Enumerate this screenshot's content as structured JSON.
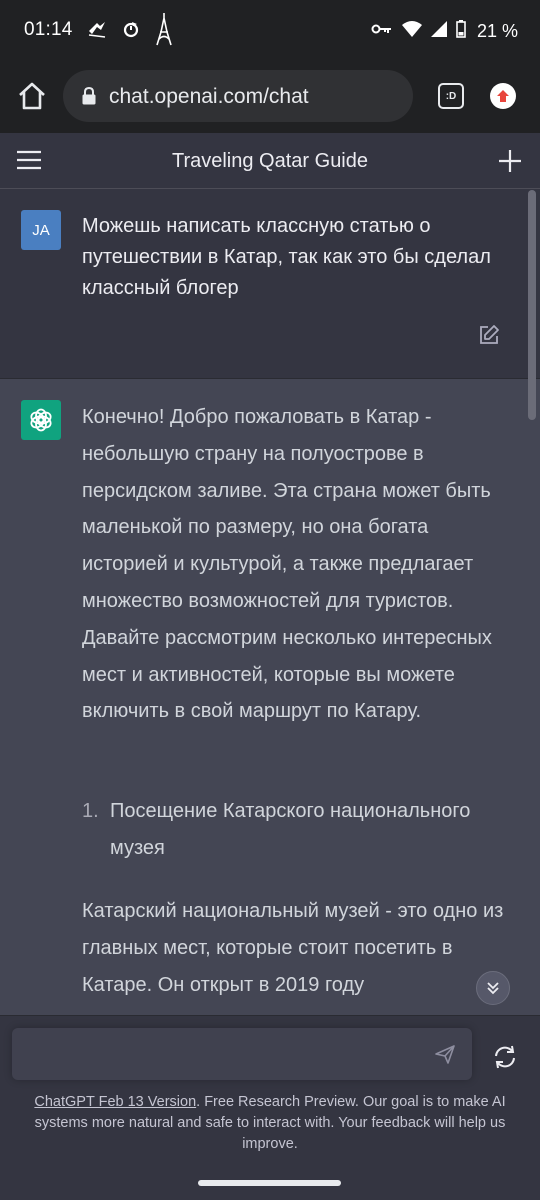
{
  "status_bar": {
    "time": "01:14",
    "battery_percent": "21 %",
    "left_icons": [
      "tiktok-icon",
      "refresh-icon",
      "eiffel-tower-icon"
    ],
    "right_icons": [
      "key-icon",
      "wifi-icon",
      "signal-icon",
      "battery-icon"
    ]
  },
  "browser": {
    "url": "chat.openai.com/chat",
    "tabs_label": ":D"
  },
  "chat": {
    "title": "Traveling Qatar Guide"
  },
  "user_message": {
    "avatar_initials": "JA",
    "text": "Можешь написать классную статью о путешествии в Катар, так как это бы сделал классный блогер"
  },
  "assistant_message": {
    "paragraph_1": "Конечно! Добро пожаловать в Катар - небольшую страну на полуострове в персидском заливе. Эта страна может быть маленькой по размеру, но она богата историей и культурой, а также предлагает множество возможностей для туристов. Давайте рассмотрим несколько интересных мест и активностей, которые вы можете включить в свой маршрут по Катару.",
    "list_item_1_number": "1.",
    "list_item_1_text": "Посещение Катарского национального музея",
    "paragraph_2": "Катарский национальный музей - это одно из главных мест, которые стоит посетить в Катаре. Он открыт в 2019 году"
  },
  "footer": {
    "version_link": "ChatGPT Feb 13 Version",
    "text": ". Free Research Preview. Our goal is to make AI systems more natural and safe to interact with. Your feedback will help us improve."
  },
  "colors": {
    "page_bg": "#343541",
    "assistant_bg": "#444654",
    "user_avatar": "#4a7fc1",
    "assistant_avatar": "#10a37f"
  }
}
